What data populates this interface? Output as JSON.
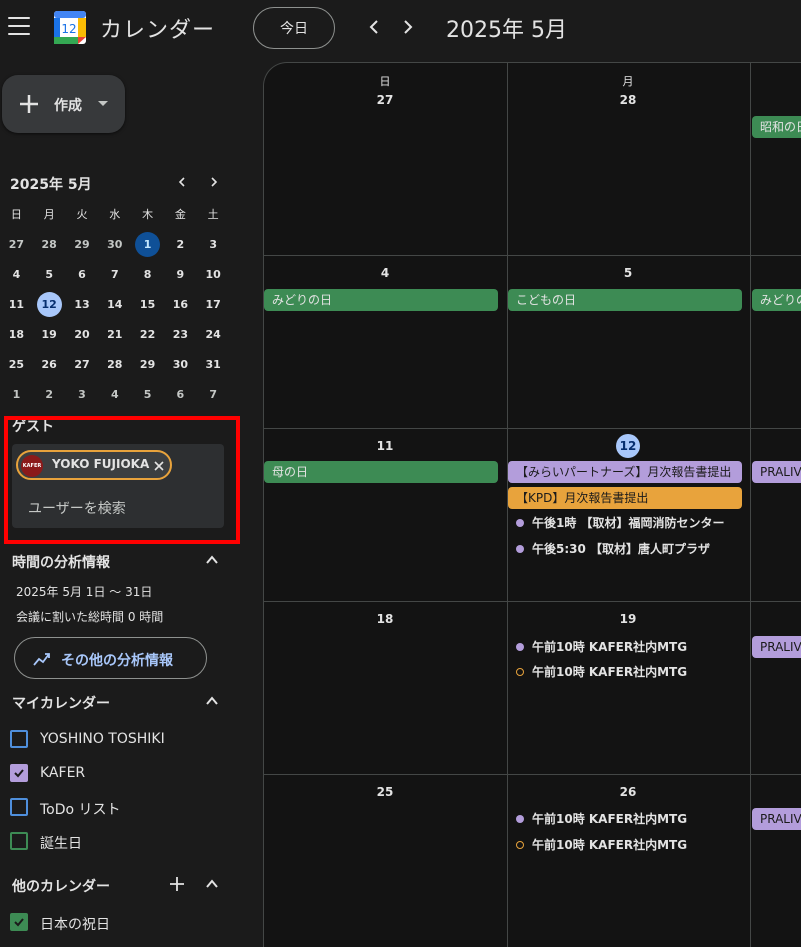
{
  "header": {
    "app_logo_number": "12",
    "app_title": "カレンダー",
    "today_label": "今日",
    "month_title": "2025年 5月"
  },
  "sidebar": {
    "create_label": "作成",
    "mini": {
      "header": "2025年 5月",
      "dow": [
        "日",
        "月",
        "火",
        "水",
        "木",
        "金",
        "土"
      ],
      "weeks": [
        [
          "27",
          "28",
          "29",
          "30",
          "1",
          "2",
          "3"
        ],
        [
          "4",
          "5",
          "6",
          "7",
          "8",
          "9",
          "10"
        ],
        [
          "11",
          "12",
          "13",
          "14",
          "15",
          "16",
          "17"
        ],
        [
          "18",
          "19",
          "20",
          "21",
          "22",
          "23",
          "24"
        ],
        [
          "25",
          "26",
          "27",
          "28",
          "29",
          "30",
          "31"
        ],
        [
          "1",
          "2",
          "3",
          "4",
          "5",
          "6",
          "7"
        ]
      ]
    },
    "guest": {
      "title": "ゲスト",
      "chip_name": "YOKO FUJIOKA",
      "avatar_text": "KAFER",
      "search_placeholder": "ユーザーを検索"
    },
    "analytics": {
      "title": "時間の分析情報",
      "range": "2025年 5月 1日 〜 31日",
      "meeting_time": "会議に割いた総時間 0 時間",
      "more_label": "その他の分析情報"
    },
    "my_calendars": {
      "title": "マイカレンダー",
      "items": [
        {
          "label": "YOSHINO TOSHIKI",
          "checked": false,
          "color": "#4f8fdc"
        },
        {
          "label": "KAFER",
          "checked": true,
          "color": "#b39ddb"
        },
        {
          "label": "ToDo リスト",
          "checked": false,
          "color": "#4f8fdc"
        },
        {
          "label": "誕生日",
          "checked": false,
          "color": "#3d8b54"
        }
      ]
    },
    "other_calendars": {
      "title": "他のカレンダー",
      "items": [
        {
          "label": "日本の祝日",
          "checked": true,
          "color": "#3d8b54"
        }
      ]
    }
  },
  "grid": {
    "dow": [
      "日",
      "月"
    ],
    "weeks": [
      {
        "sun": "27",
        "mon": "28"
      },
      {
        "sun": "4",
        "mon": "5"
      },
      {
        "sun": "11",
        "mon": "12"
      },
      {
        "sun": "18",
        "mon": "19"
      },
      {
        "sun": "25",
        "mon": "26"
      }
    ],
    "events": {
      "w1_tue": "昭和の日",
      "w2_sun": "みどりの日",
      "w2_mon": "こどもの日",
      "w2_tue": "みどりの日",
      "w3_sun": "母の日",
      "w3_mon_1": "【みらいパートナーズ】月次報告書提出",
      "w3_mon_2": "【KPD】月次報告書提出",
      "w3_mon_3": "午後1時 【取材】福岡消防センター",
      "w3_mon_4": "午後5:30 【取材】唐人町プラザ",
      "w3_tue": "PRALIVE",
      "w4_mon_1": "午前10時 KAFER社内MTG",
      "w4_mon_2": "午前10時 KAFER社内MTG",
      "w4_tue": "PRALIVE",
      "w5_mon_1": "午前10時 KAFER社内MTG",
      "w5_mon_2": "午前10時 KAFER社内MTG",
      "w5_tue": "PRALIVE"
    }
  },
  "colors": {
    "holiday": "#3d8b54",
    "kafer": "#b39ddb",
    "kpd": "#e8a33c",
    "highlight_frame": "#ff0000",
    "today": "#a8c7fa"
  }
}
